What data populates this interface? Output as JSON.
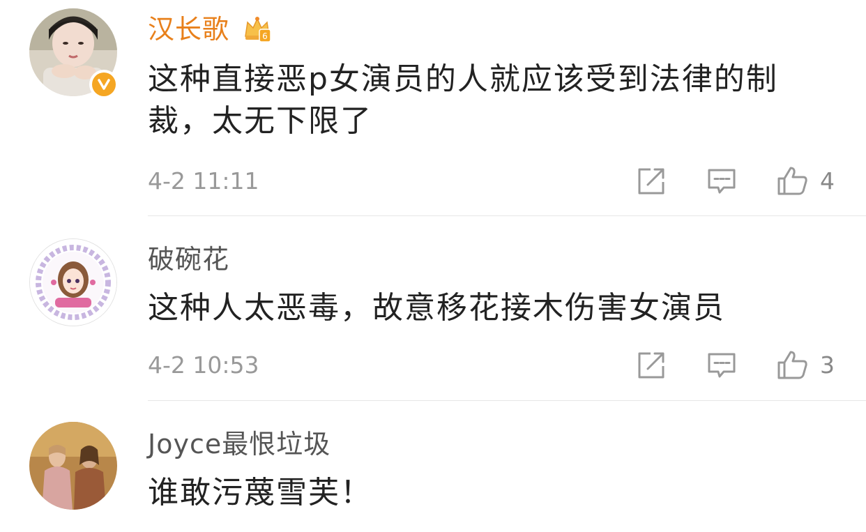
{
  "comments": [
    {
      "username": "汉长歌",
      "content": "这种直接恶p女演员的人就应该受到法律的制裁，太无下限了",
      "timestamp": "4-2 11:11",
      "like_count": "4",
      "verified": true,
      "vip_crown_level": "6"
    },
    {
      "username": "破碗花",
      "content": "这种人太恶毒，故意移花接木伤害女演员",
      "timestamp": "4-2 10:53",
      "like_count": "3"
    },
    {
      "username": "Joyce最恨垃圾",
      "content": "谁敢污蔑雪芙！"
    }
  ],
  "icons": {
    "share": "share-icon",
    "reply": "comment-icon",
    "like": "thumbs-up-icon"
  },
  "colors": {
    "vip_name": "#e8801b",
    "verified_badge": "#f5a623",
    "icon_gray": "#999999"
  }
}
